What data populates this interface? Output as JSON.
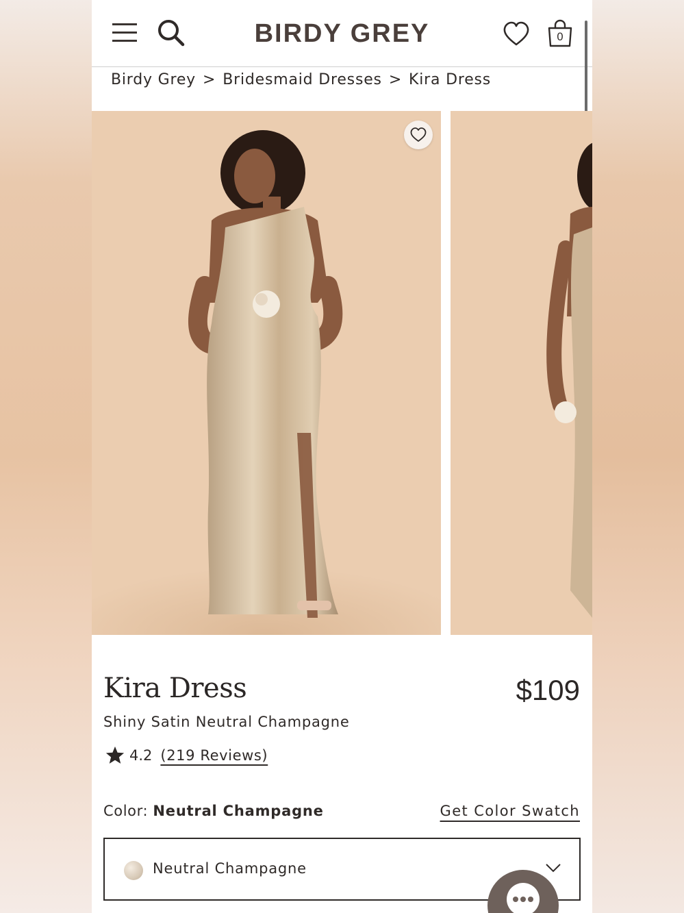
{
  "header": {
    "logo": "BIRDY GREY",
    "menu_icon": "hamburger-menu-icon",
    "search_icon": "search-icon",
    "wishlist_icon": "heart-icon",
    "bag_icon": "shopping-bag-icon",
    "bag_count": "0"
  },
  "breadcrumb": {
    "items": [
      "Birdy Grey",
      "Bridesmaid Dresses",
      "Kira Dress"
    ],
    "separator": ">"
  },
  "gallery": {
    "favorite_icon": "heart-outline-icon",
    "slides": [
      "product-photo-front",
      "product-photo-side"
    ]
  },
  "product": {
    "name": "Kira Dress",
    "price": "$109",
    "subtitle": "Shiny Satin Neutral Champagne",
    "rating": "4.2",
    "reviews": "(219 Reviews)",
    "rating_icon": "star-icon"
  },
  "color": {
    "label": "Color: ",
    "selected": "Neutral Champagne",
    "swatch_link": "Get Color Swatch",
    "select_value": "Neutral Champagne",
    "dropdown_icon": "chevron-down-icon"
  },
  "chat": {
    "icon": "chat-bubble-icon"
  },
  "colors": {
    "text": "#2e2a28",
    "logo": "#4a3f3b",
    "photo_bg": "#ebcdb0",
    "dress": "#cdb596",
    "chat_button": "#6e615b"
  }
}
